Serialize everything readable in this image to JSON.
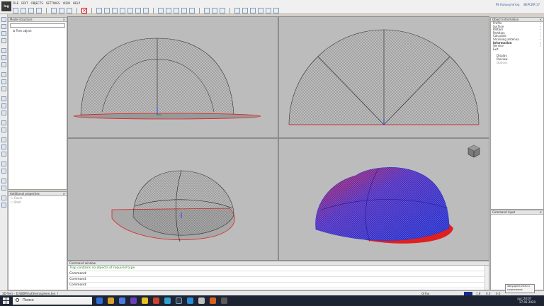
{
  "app": {
    "logo_text": "Ing",
    "menu": [
      "FILE",
      "EDIT",
      "OBJECTS",
      "SETTINGS",
      "VIEW",
      "HELP"
    ],
    "top_right": [
      "РЕ  Калькулятор",
      "ВЕРСИЯ 17"
    ]
  },
  "left_panels": {
    "model_structure_title": "Model structure",
    "model_tree_item": "Tent object",
    "additional_properties_title": "Additional properties",
    "prop_rows": [
      "Cover",
      "Shell"
    ]
  },
  "right_panel": {
    "title": "Object information",
    "items": [
      {
        "label": "Profile",
        "arrow": true,
        "bold": false
      },
      {
        "label": "Surface",
        "arrow": true,
        "bold": false
      },
      {
        "label": "Pattern",
        "arrow": true,
        "bold": false
      },
      {
        "label": "Partition",
        "arrow": true,
        "bold": false
      },
      {
        "label": "Calculate",
        "arrow": true,
        "bold": false
      },
      {
        "label": "Shrinking antenna",
        "arrow": true,
        "bold": false
      },
      {
        "label": "Information",
        "arrow": true,
        "bold": true
      },
      {
        "label": "Service",
        "arrow": true,
        "bold": false
      },
      {
        "label": "Exit",
        "arrow": false,
        "bold": false
      }
    ],
    "sub_items": [
      "Display",
      "Preview",
      "Options"
    ],
    "lower_title": "Command input"
  },
  "command": {
    "title": "Command window",
    "lines": [
      {
        "text": "Trap contains no objects of required type",
        "style": "green"
      },
      {
        "text": "Command:",
        "style": ""
      },
      {
        "text": "Command:",
        "style": ""
      },
      {
        "text": "Command:",
        "style": ""
      }
    ]
  },
  "status": {
    "left": "3D-Tent – D:\\BDM\\hat\\hemisphere.ten ↑",
    "mode": "Ortho",
    "coords": [
      "1.8",
      "0.0",
      "0.0"
    ]
  },
  "taskbar": {
    "search_placeholder": "Поиск",
    "tray_lang": "РУС",
    "time": "20:07",
    "date": "27.02.2020"
  },
  "toast": {
    "line1": "Запущена 2020-1",
    "line2": "сохранение"
  },
  "colors": {
    "viewport_bg": "#bcbcbc",
    "mesh": "#555555",
    "red_edge": "#e02020",
    "stress_blue": "#2030d0",
    "stress_red": "#d02040"
  }
}
